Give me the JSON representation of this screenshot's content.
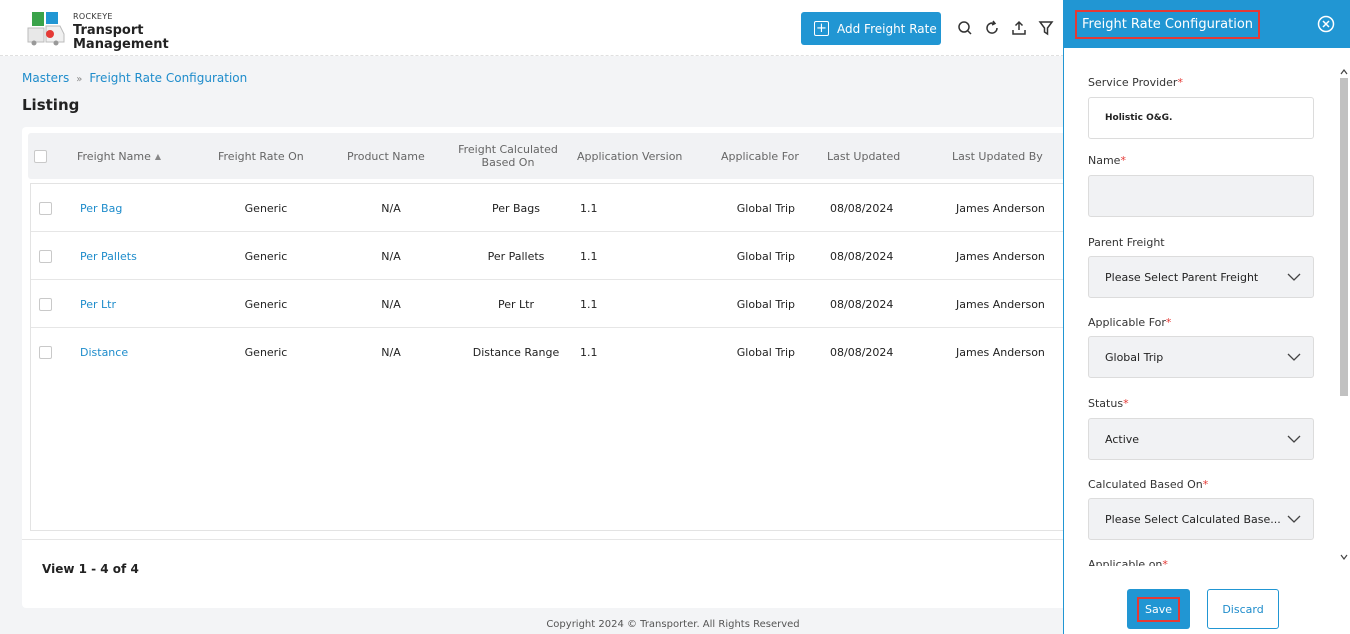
{
  "brand": {
    "small": "ROCKEYE",
    "line1": "Transport",
    "line2": "Management"
  },
  "toolbar": {
    "add_label": "Add Freight Rate",
    "icons": [
      "search-icon",
      "refresh-icon",
      "upload-icon",
      "filter-icon"
    ]
  },
  "breadcrumb": {
    "root": "Masters",
    "current": "Freight Rate Configuration"
  },
  "page_title": "Listing",
  "table": {
    "columns": [
      "Freight Name",
      "Freight Rate On",
      "Product Name",
      "Freight Calculated Based On",
      "Application Version",
      "Applicable For",
      "Last Updated",
      "Last Updated By"
    ],
    "rows": [
      {
        "name": "Per Bag",
        "rate_on": "Generic",
        "product": "N/A",
        "based_on": "Per Bags",
        "version": "1.1",
        "applicable": "Global Trip",
        "updated": "08/08/2024",
        "by": "James Anderson"
      },
      {
        "name": "Per Pallets",
        "rate_on": "Generic",
        "product": "N/A",
        "based_on": "Per Pallets",
        "version": "1.1",
        "applicable": "Global Trip",
        "updated": "08/08/2024",
        "by": "James Anderson"
      },
      {
        "name": "Per Ltr",
        "rate_on": "Generic",
        "product": "N/A",
        "based_on": "Per Ltr",
        "version": "1.1",
        "applicable": "Global Trip",
        "updated": "08/08/2024",
        "by": "James Anderson"
      },
      {
        "name": "Distance",
        "rate_on": "Generic",
        "product": "N/A",
        "based_on": "Distance Range",
        "version": "1.1",
        "applicable": "Global Trip",
        "updated": "08/08/2024",
        "by": "James Anderson"
      }
    ]
  },
  "pager": {
    "text": "View 1 - 4 of 4"
  },
  "footer": {
    "copyright": "Copyright 2024 © Transporter. All Rights Reserved"
  },
  "panel": {
    "title": "Freight Rate Configuration",
    "fields": {
      "service_provider": {
        "label": "Service Provider",
        "value": "Holistic O&G."
      },
      "name": {
        "label": "Name",
        "value": ""
      },
      "parent_freight": {
        "label": "Parent Freight",
        "value": "Please Select Parent Freight"
      },
      "applicable_for": {
        "label": "Applicable For",
        "value": "Global Trip"
      },
      "status": {
        "label": "Status",
        "value": "Active"
      },
      "calculated_based_on": {
        "label": "Calculated Based On",
        "value": "Please Select Calculated Base..."
      },
      "applicable_on": {
        "label": "Applicable on"
      }
    },
    "required_mark": "*",
    "save_label": "Save",
    "discard_label": "Discard"
  },
  "colors": {
    "accent": "#2196d3",
    "highlight": "#e53935"
  }
}
